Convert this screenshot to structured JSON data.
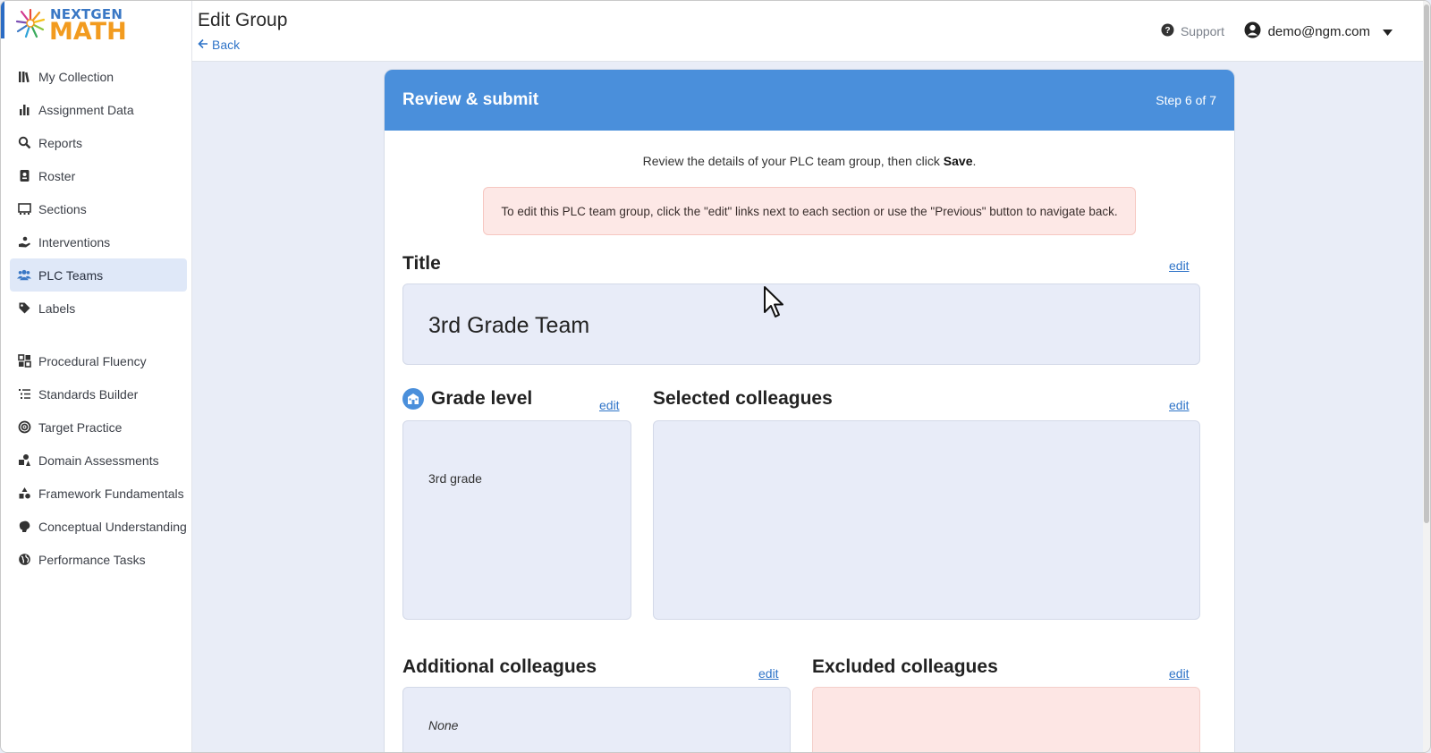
{
  "brand": {
    "line1": "NEXTGEN",
    "line2": "MATH"
  },
  "header": {
    "title": "Edit Group",
    "back": "Back",
    "support": "Support",
    "user_email": "demo@ngm.com"
  },
  "sidebar": {
    "items": [
      {
        "label": "My Collection",
        "icon": "books-icon"
      },
      {
        "label": "Assignment Data",
        "icon": "bar-chart-icon"
      },
      {
        "label": "Reports",
        "icon": "magnifier-icon"
      },
      {
        "label": "Roster",
        "icon": "id-card-icon"
      },
      {
        "label": "Sections",
        "icon": "sections-icon"
      },
      {
        "label": "Interventions",
        "icon": "hand-icon"
      },
      {
        "label": "PLC Teams",
        "icon": "users-icon",
        "active": true
      },
      {
        "label": "Labels",
        "icon": "tag-icon"
      }
    ],
    "tools": [
      {
        "label": "Procedural Fluency",
        "icon": "grid-icon"
      },
      {
        "label": "Standards Builder",
        "icon": "list-icon"
      },
      {
        "label": "Target Practice",
        "icon": "target-icon"
      },
      {
        "label": "Domain Assessments",
        "icon": "shapes-icon"
      },
      {
        "label": "Framework Fundamentals",
        "icon": "blocks-icon"
      },
      {
        "label": "Conceptual Understanding",
        "icon": "brain-icon"
      },
      {
        "label": "Performance Tasks",
        "icon": "globe-icon"
      }
    ]
  },
  "card": {
    "heading": "Review & submit",
    "step": "Step 6 of 7",
    "intro_prefix": "Review the details of your PLC team group, then click ",
    "intro_bold": "Save",
    "intro_suffix": ".",
    "alert": "To edit this PLC team group, click the \"edit\" links next to each section or use the \"Previous\" button to navigate back.",
    "edit_label": "edit",
    "title_section": {
      "label": "Title",
      "value": "3rd Grade Team"
    },
    "grade_section": {
      "label": "Grade level",
      "value": "3rd grade"
    },
    "selected_section": {
      "label": "Selected colleagues",
      "value": ""
    },
    "additional_section": {
      "label": "Additional colleagues",
      "value": "None"
    },
    "excluded_section": {
      "label": "Excluded colleagues",
      "value": ""
    }
  },
  "colors": {
    "accent": "#4a8fdb",
    "link": "#2f74c8",
    "alert_bg": "#fde8e6",
    "box_bg": "#e8ecf8"
  }
}
